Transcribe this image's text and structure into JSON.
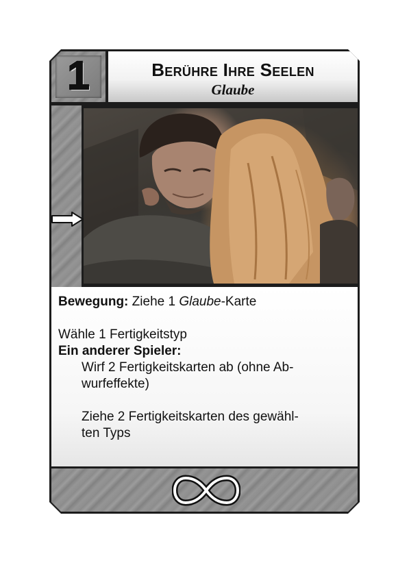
{
  "card": {
    "cost": "1",
    "title": "Berühre Ihre Seelen",
    "type": "Glaube",
    "movement_label": "Bewegung:",
    "movement_pre": "Ziehe 1 ",
    "movement_type": "Glaube",
    "movement_post": "-Karte",
    "choose_line": "Wähle 1 Fertigkeitstyp",
    "other_player_label": "Ein anderer Spieler:",
    "effect_1_line1": "Wirf 2 Fertigkeitskarten ab (ohne Ab-",
    "effect_1_line2": "wurfeffekte)",
    "effect_2_line1": "Ziehe 2 Fertigkeitskarten des gewähl-",
    "effect_2_line2": "ten Typs",
    "icons": {
      "side": "arrow-right-icon",
      "bottom": "infinity-icon"
    }
  },
  "colors": {
    "frame": "#1c1c1c",
    "metal": "#8e8e8e",
    "panel": "#f6f6f6",
    "text": "#111111"
  }
}
